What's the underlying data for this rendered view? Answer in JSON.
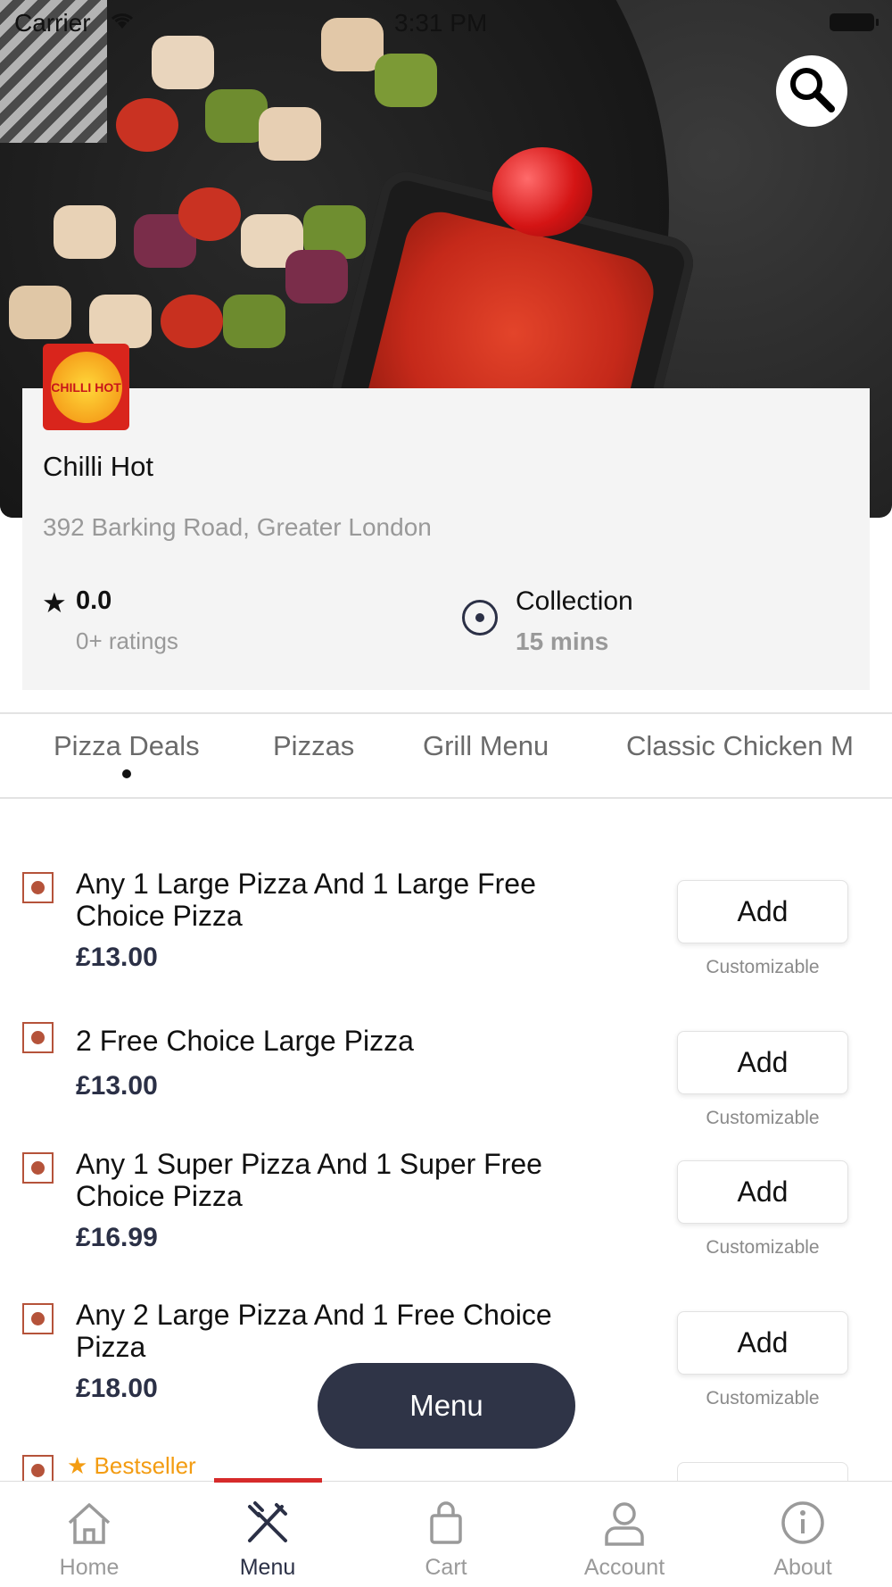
{
  "status_bar": {
    "carrier": "Carrier",
    "time": "3:31 PM"
  },
  "header": {
    "search_icon": "search-icon"
  },
  "restaurant": {
    "logo_text": "CHILLI HOT",
    "name": "Chilli Hot",
    "address": "392 Barking Road, Greater London",
    "rating_value": "0.0",
    "rating_count": "0+ ratings",
    "collection_label": "Collection",
    "collection_time": "15 mins"
  },
  "tabs": [
    {
      "label": "Pizza Deals",
      "active": true
    },
    {
      "label": "Pizzas",
      "active": false
    },
    {
      "label": "Grill Menu",
      "active": false
    },
    {
      "label": "Classic Chicken M",
      "active": false
    }
  ],
  "items": [
    {
      "name": "Any 1 Large Pizza And 1 Large Free Choice Pizza",
      "price": "£13.00",
      "button": "Add",
      "note": "Customizable"
    },
    {
      "name": "2 Free Choice Large Pizza",
      "price": "£13.00",
      "button": "Add",
      "note": "Customizable"
    },
    {
      "name": "Any 1 Super Pizza And 1 Super Free Choice Pizza",
      "price": "£16.99",
      "button": "Add",
      "note": "Customizable"
    },
    {
      "name": "Any 2 Large Pizza And 1 Free Choice Pizza",
      "price": "£18.00",
      "button": "Add",
      "note": "Customizable"
    }
  ],
  "bestseller_label": "Bestseller",
  "menu_button": "Menu",
  "bottom_nav": [
    {
      "label": "Home",
      "icon": "home-icon",
      "active": false
    },
    {
      "label": "Menu",
      "icon": "menu-icon",
      "active": true
    },
    {
      "label": "Cart",
      "icon": "cart-icon",
      "active": false
    },
    {
      "label": "Account",
      "icon": "account-icon",
      "active": false
    },
    {
      "label": "About",
      "icon": "info-icon",
      "active": false
    }
  ],
  "colors": {
    "accent": "#d62a2a",
    "dark": "#2f3447",
    "veg_marker": "#b5533a",
    "bestseller": "#f39c12"
  }
}
